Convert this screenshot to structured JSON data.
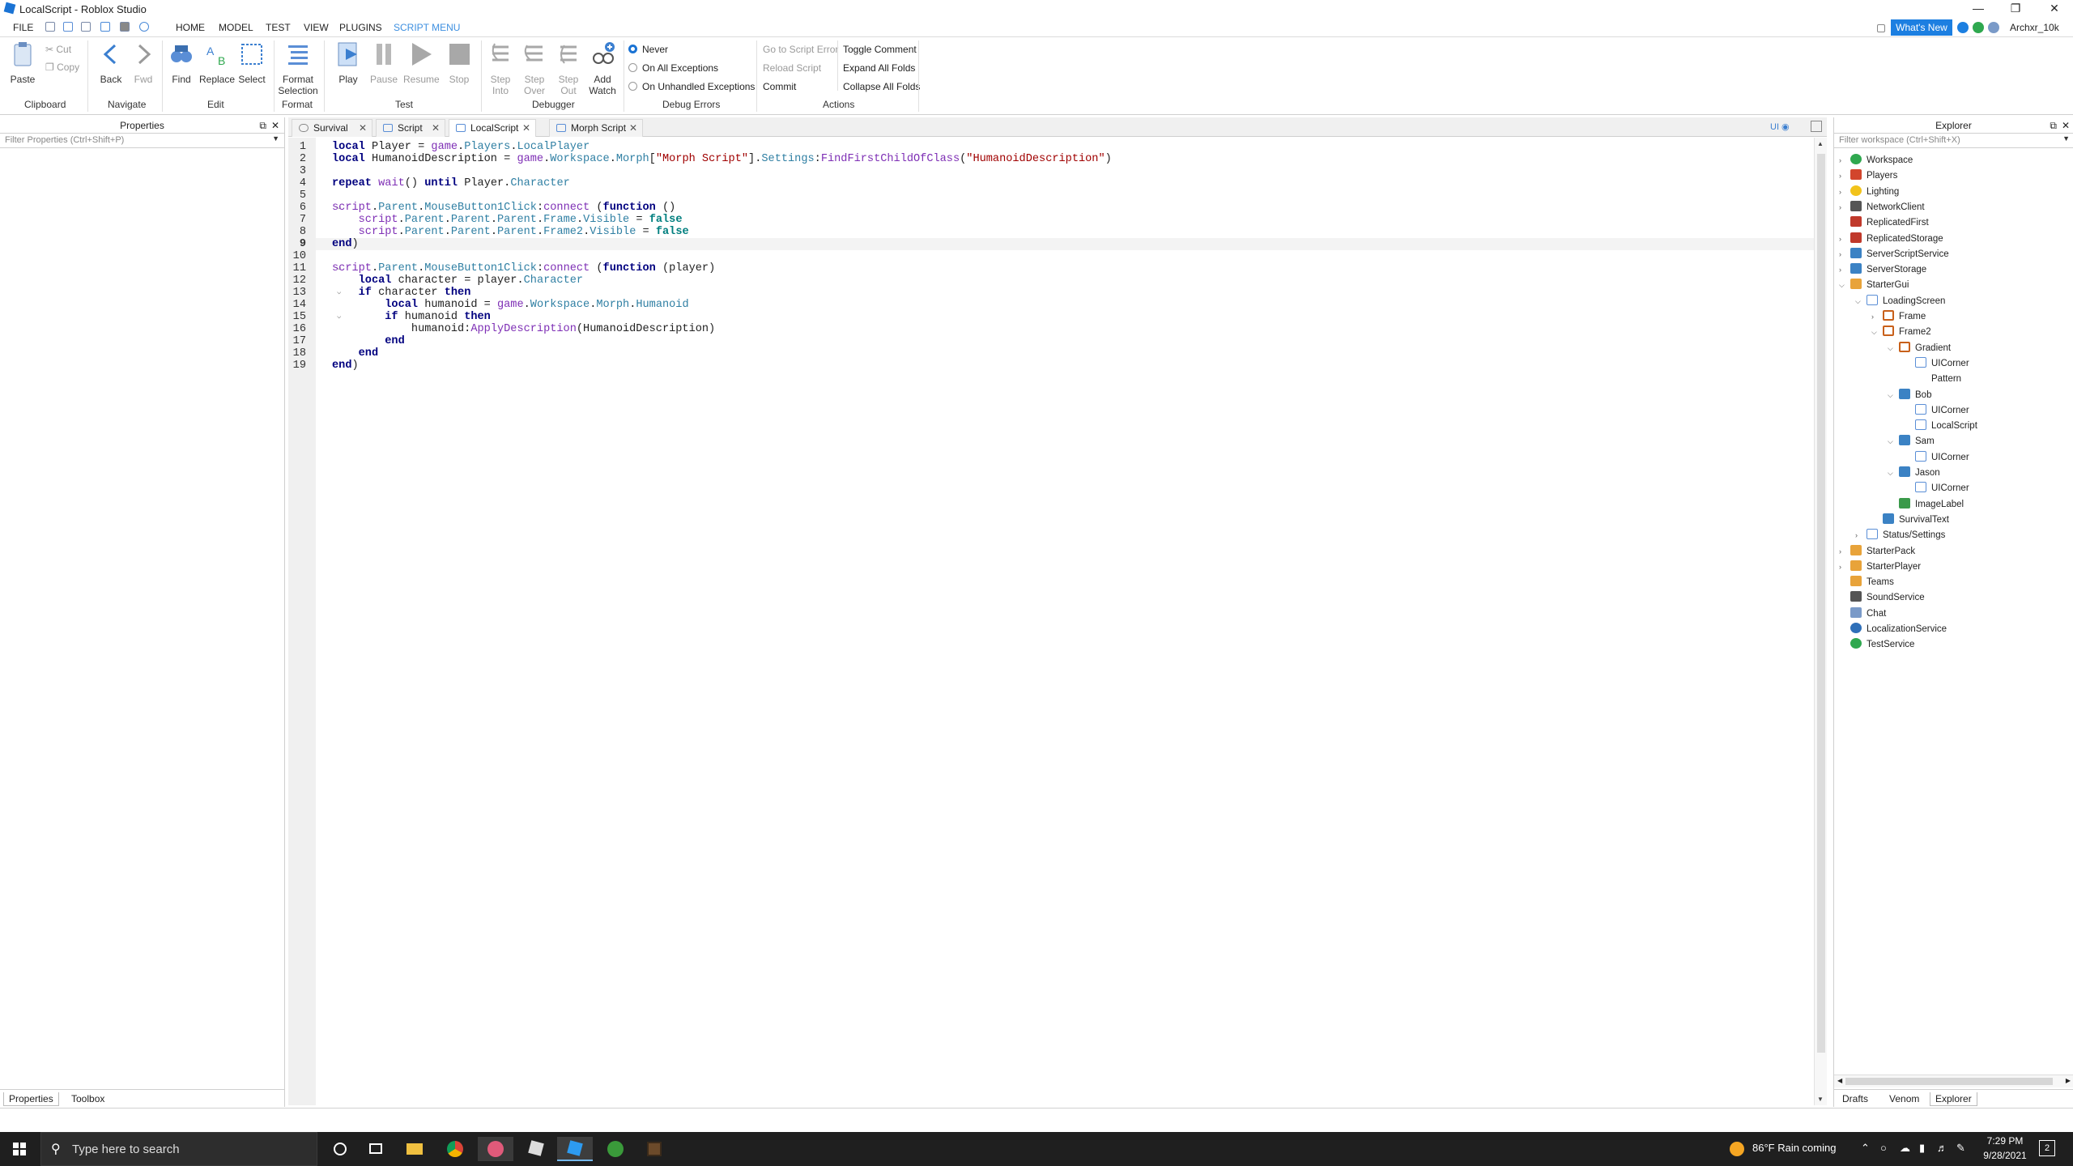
{
  "window": {
    "title": "LocalScript - Roblox Studio"
  },
  "menu": {
    "file": "FILE",
    "tabs": [
      "HOME",
      "MODEL",
      "TEST",
      "VIEW",
      "PLUGINS",
      "SCRIPT MENU"
    ],
    "whats_new": "What's New",
    "username": "Archxr_10k"
  },
  "ribbon": {
    "clipboard": {
      "paste": "Paste",
      "cut": "Cut",
      "copy": "Copy",
      "label": "Clipboard"
    },
    "navigate": {
      "back": "Back",
      "fwd": "Fwd",
      "label": "Navigate"
    },
    "edit": {
      "find": "Find",
      "replace": "Replace",
      "select": "Select",
      "label": "Edit"
    },
    "format": {
      "format_selection": "Format\nSelection",
      "label": "Format"
    },
    "test": {
      "play": "Play",
      "pause": "Pause",
      "resume": "Resume",
      "stop": "Stop",
      "label": "Test"
    },
    "debugger": {
      "step_into": "Step\nInto",
      "step_over": "Step\nOver",
      "step_out": "Step\nOut",
      "add_watch": "Add\nWatch",
      "label": "Debugger"
    },
    "debug_errors": {
      "never": "Never",
      "on_all": "On All Exceptions",
      "on_unhandled": "On Unhandled Exceptions",
      "label": "Debug Errors"
    },
    "actions": {
      "go_to_script_error": "Go to Script Error",
      "reload_script": "Reload Script",
      "commit": "Commit",
      "toggle_comment": "Toggle Comment",
      "expand_all_folds": "Expand All Folds",
      "collapse_all_folds": "Collapse All Folds",
      "label": "Actions"
    }
  },
  "properties": {
    "title": "Properties",
    "filter_placeholder": "Filter Properties (Ctrl+Shift+P)",
    "tabs": [
      "Properties",
      "Toolbox"
    ]
  },
  "editor": {
    "tabs": [
      "Survival",
      "Script",
      "LocalScript",
      "Morph Script"
    ],
    "active_tab": "LocalScript",
    "current_line": 9,
    "line_count": 19,
    "ui_badge": "UI"
  },
  "code_lines": [
    [
      "local Player = game.Players.LocalPlayer"
    ],
    [
      "local HumanoidDescription = game.Workspace.Morph[\"Morph Script\"].Settings:FindFirstChildOfClass(\"HumanoidDescription\")"
    ],
    [
      ""
    ],
    [
      "repeat wait() until Player.Character"
    ],
    [
      ""
    ],
    [
      "script.Parent.MouseButton1Click:connect (function ()"
    ],
    [
      "    script.Parent.Parent.Parent.Frame.Visible = false"
    ],
    [
      "    script.Parent.Parent.Parent.Frame2.Visible = false"
    ],
    [
      "end)"
    ],
    [
      ""
    ],
    [
      "script.Parent.MouseButton1Click:connect (function (player)"
    ],
    [
      "    local character = player.Character"
    ],
    [
      "    if character then"
    ],
    [
      "        local humanoid = game.Workspace.Morph.Humanoid"
    ],
    [
      "        if humanoid then"
    ],
    [
      "            humanoid:ApplyDescription(HumanoidDescription)"
    ],
    [
      "        end"
    ],
    [
      "    end"
    ],
    [
      "end)"
    ]
  ],
  "explorer": {
    "title": "Explorer",
    "filter_placeholder": "Filter workspace (Ctrl+Shift+X)",
    "tabs": [
      "Drafts",
      "Venom",
      "Explorer"
    ],
    "tree": [
      {
        "label": "Workspace",
        "depth": 0,
        "twisty": "closed",
        "icon": "globe-icon",
        "color": "#2fa84f"
      },
      {
        "label": "Players",
        "depth": 0,
        "twisty": "closed",
        "icon": "players-icon",
        "color": "#d2452c"
      },
      {
        "label": "Lighting",
        "depth": 0,
        "twisty": "closed",
        "icon": "bulb-icon",
        "color": "#f2c31b"
      },
      {
        "label": "NetworkClient",
        "depth": 0,
        "twisty": "closed",
        "icon": "network-icon",
        "color": "#555555"
      },
      {
        "label": "ReplicatedFirst",
        "depth": 0,
        "twisty": "none",
        "icon": "replicated-icon",
        "color": "#c0392b"
      },
      {
        "label": "ReplicatedStorage",
        "depth": 0,
        "twisty": "closed",
        "icon": "storage-icon",
        "color": "#c0392b"
      },
      {
        "label": "ServerScriptService",
        "depth": 0,
        "twisty": "closed",
        "icon": "server-script-icon",
        "color": "#3b82c4"
      },
      {
        "label": "ServerStorage",
        "depth": 0,
        "twisty": "closed",
        "icon": "server-storage-icon",
        "color": "#3b82c4"
      },
      {
        "label": "StarterGui",
        "depth": 0,
        "twisty": "open",
        "icon": "gui-icon",
        "color": "#e8a33a"
      },
      {
        "label": "LoadingScreen",
        "depth": 1,
        "twisty": "open",
        "icon": "screengui-icon",
        "color": "#5a8ed6"
      },
      {
        "label": "Frame",
        "depth": 2,
        "twisty": "closed",
        "icon": "frame-icon",
        "color": "#c8601a"
      },
      {
        "label": "Frame2",
        "depth": 2,
        "twisty": "open",
        "icon": "frame-icon",
        "color": "#c8601a"
      },
      {
        "label": "Gradient",
        "depth": 3,
        "twisty": "open",
        "icon": "frame-icon",
        "color": "#c8601a"
      },
      {
        "label": "UICorner",
        "depth": 4,
        "twisty": "none",
        "icon": "uicorner-icon",
        "color": "#5a8ed6"
      },
      {
        "label": "Pattern",
        "depth": 4,
        "twisty": "none",
        "icon": "",
        "color": ""
      },
      {
        "label": "Bob",
        "depth": 3,
        "twisty": "open",
        "icon": "button-icon",
        "color": "#3b82c4"
      },
      {
        "label": "UICorner",
        "depth": 4,
        "twisty": "none",
        "icon": "uicorner-icon",
        "color": "#5a8ed6"
      },
      {
        "label": "LocalScript",
        "depth": 4,
        "twisty": "none",
        "icon": "localscript-icon",
        "color": "#5a8ed6"
      },
      {
        "label": "Sam",
        "depth": 3,
        "twisty": "open",
        "icon": "button-icon",
        "color": "#3b82c4"
      },
      {
        "label": "UICorner",
        "depth": 4,
        "twisty": "none",
        "icon": "uicorner-icon",
        "color": "#5a8ed6"
      },
      {
        "label": "Jason",
        "depth": 3,
        "twisty": "open",
        "icon": "button-icon",
        "color": "#3b82c4"
      },
      {
        "label": "UICorner",
        "depth": 4,
        "twisty": "none",
        "icon": "uicorner-icon",
        "color": "#5a8ed6"
      },
      {
        "label": "ImageLabel",
        "depth": 3,
        "twisty": "none",
        "icon": "imagelabel-icon",
        "color": "#3a9a4a"
      },
      {
        "label": "SurvivalText",
        "depth": 2,
        "twisty": "none",
        "icon": "textlabel-icon",
        "color": "#3b82c4"
      },
      {
        "label": "Status/Settings",
        "depth": 1,
        "twisty": "closed",
        "icon": "screengui-icon",
        "color": "#5a8ed6"
      },
      {
        "label": "StarterPack",
        "depth": 0,
        "twisty": "closed",
        "icon": "pack-icon",
        "color": "#e8a33a"
      },
      {
        "label": "StarterPlayer",
        "depth": 0,
        "twisty": "closed",
        "icon": "starterplayer-icon",
        "color": "#e8a33a"
      },
      {
        "label": "Teams",
        "depth": 0,
        "twisty": "none",
        "icon": "teams-icon",
        "color": "#e8a33a"
      },
      {
        "label": "SoundService",
        "depth": 0,
        "twisty": "none",
        "icon": "sound-icon",
        "color": "#555555"
      },
      {
        "label": "Chat",
        "depth": 0,
        "twisty": "none",
        "icon": "chat-icon",
        "color": "#7a9ac8"
      },
      {
        "label": "LocalizationService",
        "depth": 0,
        "twisty": "none",
        "icon": "localization-icon",
        "color": "#2f6fb8"
      },
      {
        "label": "TestService",
        "depth": 0,
        "twisty": "none",
        "icon": "check-icon",
        "color": "#2fa84f"
      }
    ]
  },
  "taskbar": {
    "search_placeholder": "Type here to search",
    "weather": "86°F  Rain coming",
    "time": "7:29 PM",
    "date": "9/28/2021",
    "notification_count": "2"
  }
}
